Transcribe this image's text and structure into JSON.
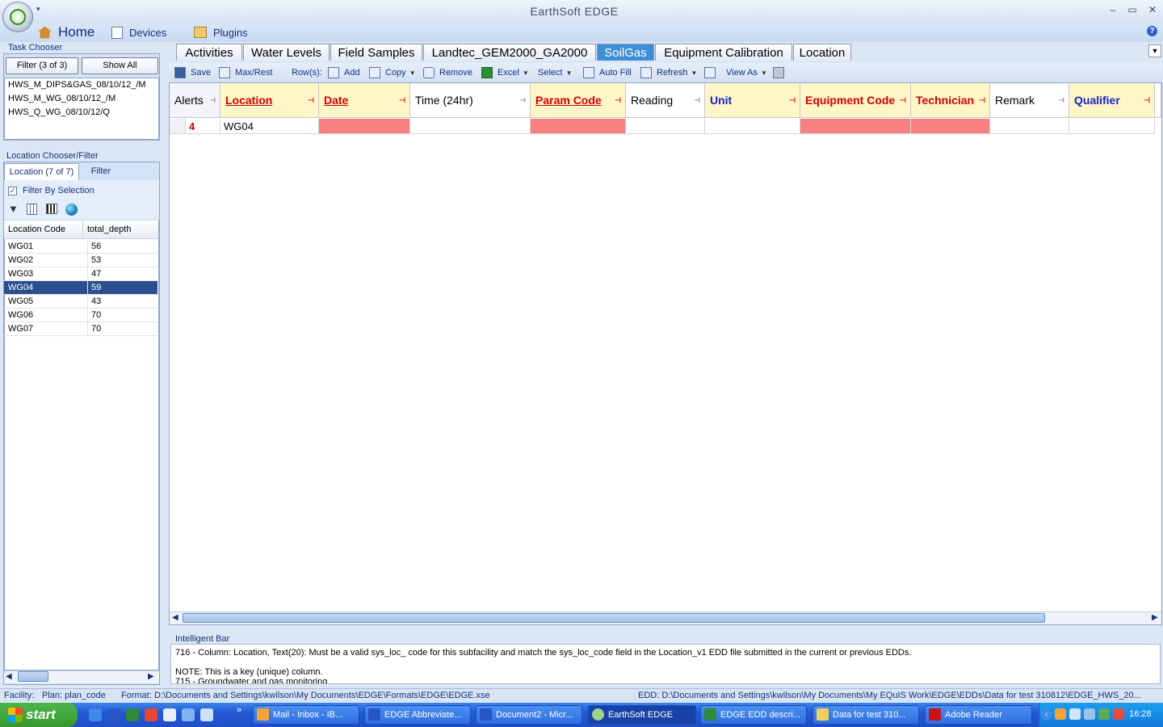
{
  "window": {
    "title": "EarthSoft EDGE",
    "qat_arrow": "▾",
    "minimize": "–",
    "maximize": "▭",
    "close": "✕"
  },
  "menu": {
    "items": [
      {
        "label": "Home",
        "icon": "home-icon"
      },
      {
        "label": "Devices",
        "icon": "devices-icon"
      },
      {
        "label": "Plugins",
        "icon": "plugins-icon"
      }
    ],
    "help": "?"
  },
  "task_chooser": {
    "title": "Task Chooser",
    "filter_button": "Filter (3 of 3)",
    "show_all_button": "Show All",
    "items": [
      "HWS_M_DIPS&GAS_08/10/12_/M",
      "HWS_M_WG_08/10/12_/M",
      "HWS_Q_WG_08/10/12/Q"
    ]
  },
  "location_chooser": {
    "title": "Location Chooser/Filter",
    "tabs": [
      "Location (7 of 7)",
      "Filter"
    ],
    "filter_by_selection": "Filter By Selection",
    "columns": [
      "Location Code",
      "total_depth"
    ],
    "rows": [
      {
        "code": "WG01",
        "depth": "56"
      },
      {
        "code": "WG02",
        "depth": "53"
      },
      {
        "code": "WG03",
        "depth": "47"
      },
      {
        "code": "WG04",
        "depth": "59"
      },
      {
        "code": "WG05",
        "depth": "43"
      },
      {
        "code": "WG06",
        "depth": "70"
      },
      {
        "code": "WG07",
        "depth": "70"
      }
    ],
    "selected_row": "WG04"
  },
  "tabs": [
    "Activities",
    "Water Levels",
    "Field Samples",
    "Landtec_GEM2000_GA2000",
    "SoilGas",
    "Equipment Calibration",
    "Location"
  ],
  "active_tab": "SoilGas",
  "toolbar": {
    "save": "Save",
    "max_rest": "Max/Rest",
    "rows": "Row(s):",
    "add": "Add",
    "copy": "Copy",
    "remove": "Remove",
    "excel": "Excel",
    "select": "Select",
    "auto_fill": "Auto Fill",
    "refresh": "Refresh",
    "view_as": "View As"
  },
  "grid": {
    "columns": [
      "Alerts",
      "Location",
      "Date",
      "Time (24hr)",
      "Param Code",
      "Reading",
      "Unit",
      "Equipment Code",
      "Technician",
      "Remark",
      "Qualifier"
    ],
    "row": {
      "alerts": "4",
      "location": "WG04",
      "date": "",
      "time": "",
      "param_code": "",
      "reading": "",
      "unit": "",
      "equipment_code": "",
      "technician": "",
      "remark": "",
      "qualifier": ""
    }
  },
  "intelligent_bar": {
    "title": "Intelligent Bar",
    "line1": "716 - Column: Location, Text(20): Must be a valid sys_loc_ code for this subfacility and match the sys_loc_code field in the Location_v1 EDD file submitted in the current or previous EDDs.",
    "line2": "NOTE: This is a key (unique) column.",
    "line3": "715 - Groundwater and gas monitoring"
  },
  "statusbar": {
    "facility": "Facility:",
    "plan": "Plan: plan_code",
    "format": "Format: D:\\Documents and Settings\\kwilson\\My Documents\\EDGE\\Formats\\EDGE\\EDGE.xse",
    "edd": "EDD: D:\\Documents and Settings\\kwilson\\My Documents\\My EQuIS Work\\EDGE\\EDDs\\Data for test 310812\\EDGE_HWS_20..."
  },
  "taskbar": {
    "start": "start",
    "more": "»",
    "tasks": [
      "Mail - Inbox - IB...",
      "EDGE Abbreviate...",
      "Document2 - Micr...",
      "EarthSoft EDGE",
      "EDGE EDD descri...",
      "Data for test 310...",
      "Adobe Reader"
    ],
    "active_task": "EarthSoft EDGE",
    "clock": "16:28"
  },
  "colors": {
    "error_cell": "#f88080",
    "required_header": "#fff6c8",
    "accent": "#3f8fd6",
    "selected_row": "#2a4f8f"
  }
}
